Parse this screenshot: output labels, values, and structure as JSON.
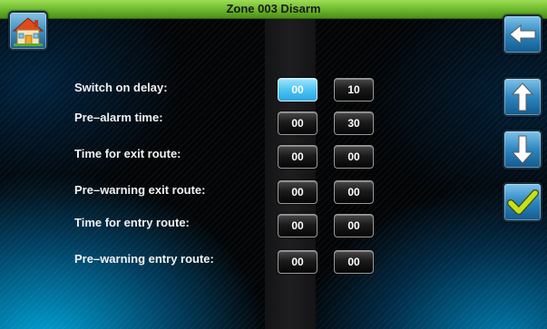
{
  "title": "Zone 003  Disarm",
  "colors": {
    "title_bar": "#6bb72c",
    "selected_field": "#4fc4f2",
    "nav_button": "#2e86c0",
    "confirm_check": "#c6e01a"
  },
  "icons": {
    "home": "house-icon",
    "back": "left-arrow-icon",
    "up": "up-arrow-icon",
    "down": "down-arrow-icon",
    "confirm": "checkmark-icon"
  },
  "rows": [
    {
      "label": "Switch on delay:",
      "field_a": "00",
      "field_b": "10",
      "selected": "field_a"
    },
    {
      "label": "Pre–alarm time:",
      "field_a": "00",
      "field_b": "30"
    },
    {
      "label": "Time for exit route:",
      "field_a": "00",
      "field_b": "00"
    },
    {
      "label": "Pre–warning exit route:",
      "field_a": "00",
      "field_b": "00"
    },
    {
      "label": "Time for entry route:",
      "field_a": "00",
      "field_b": "00"
    },
    {
      "label": "Pre–warning entry route:",
      "field_a": "00",
      "field_b": "00"
    }
  ]
}
